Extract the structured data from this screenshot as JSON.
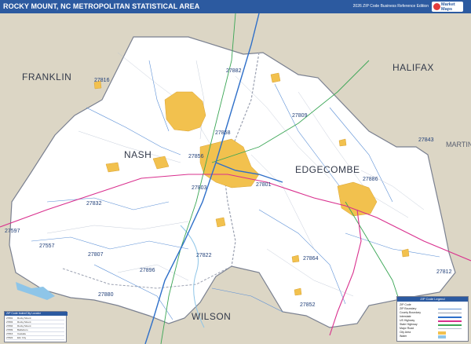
{
  "header": {
    "title": "ROCKY MOUNT, NC METROPOLITAN STATISTICAL AREA",
    "subtitle": "2026 ZIP Code Business Reference Edition",
    "logo_text": "Market Maps"
  },
  "counties": {
    "nash": "NASH",
    "edgecombe": "EDGECOMBE",
    "franklin": "FRANKLIN",
    "halifax": "HALIFAX",
    "wilson": "WILSON",
    "martin": "MARTIN"
  },
  "zip_labels": [
    "27816",
    "27882",
    "27809",
    "27858",
    "27856",
    "27803",
    "27801",
    "27886",
    "27843",
    "27832",
    "27597",
    "27557",
    "27807",
    "27822",
    "27864",
    "27896",
    "27880",
    "27852",
    "27812"
  ],
  "legend": {
    "title": "ZIP Code Legend",
    "rows": [
      "ZIP Code",
      "ZIP Boundary",
      "County Boundary",
      "Interstate",
      "US Highway",
      "State Highway",
      "Major Road",
      "City Area",
      "Water"
    ],
    "colors": {
      "interstate": "#2e6fc9",
      "us_highway": "#d9308e",
      "state_highway": "#3aa655",
      "zip_boundary": "#5a8fd6",
      "city_area": "#f2c14e",
      "water": "#8ec5e8",
      "outside": "#dcd6c5",
      "title_bar": "#2c5aa0"
    }
  },
  "zip_table": {
    "title": "ZIP Code Index/City Locator",
    "rows": [
      [
        "27801",
        "Rocky Mount"
      ],
      [
        "27803",
        "Rocky Mount"
      ],
      [
        "27804",
        "Rocky Mount"
      ],
      [
        "27809",
        "Battleboro"
      ],
      [
        "27816",
        "Castalia"
      ],
      [
        "27822",
        "Elm City"
      ]
    ]
  }
}
